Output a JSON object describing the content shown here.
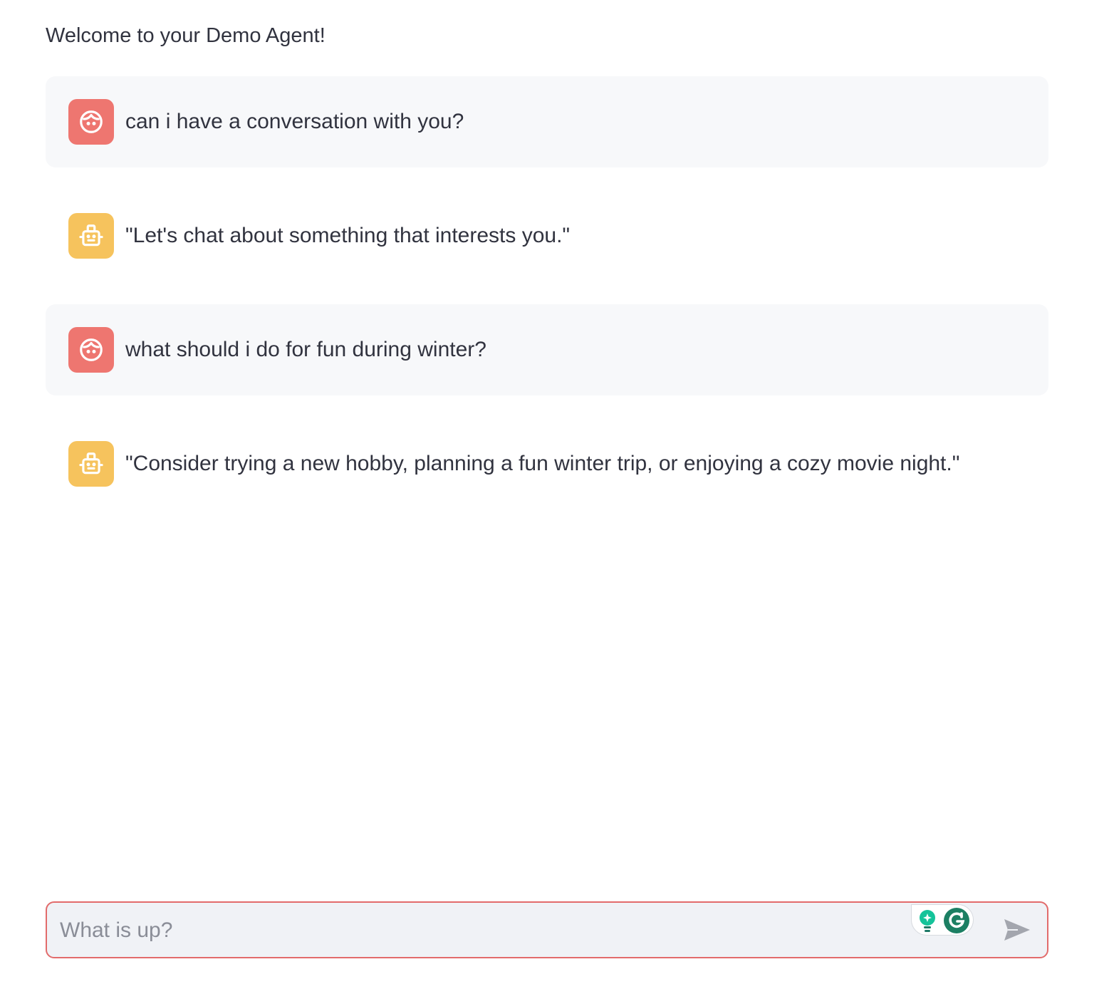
{
  "header": {
    "welcome_text": "Welcome to your Demo Agent!"
  },
  "messages": [
    {
      "role": "user",
      "avatar_icon": "user-face-icon",
      "text": "can i have a conversation with you?"
    },
    {
      "role": "assistant",
      "avatar_icon": "robot-icon",
      "text": "\"Let's chat about something that interests you.\""
    },
    {
      "role": "user",
      "avatar_icon": "user-face-icon",
      "text": "what should i do for fun during winter?"
    },
    {
      "role": "assistant",
      "avatar_icon": "robot-icon",
      "text": "\"Consider trying a new hobby, planning a fun winter trip, or enjoying a cozy movie night.\""
    }
  ],
  "chat_input": {
    "placeholder": "What is up?",
    "value": "",
    "send_icon": "send-icon",
    "extension_icons": [
      "grammarly-bulb-icon",
      "grammarly-logo-icon"
    ]
  },
  "colors": {
    "user_avatar": "#ee7670",
    "assistant_avatar": "#f6c35d",
    "user_bubble": "#f7f8fa",
    "input_border": "#e26b6b",
    "input_background": "#f0f2f6",
    "grammarly_green": "#15c39a"
  }
}
